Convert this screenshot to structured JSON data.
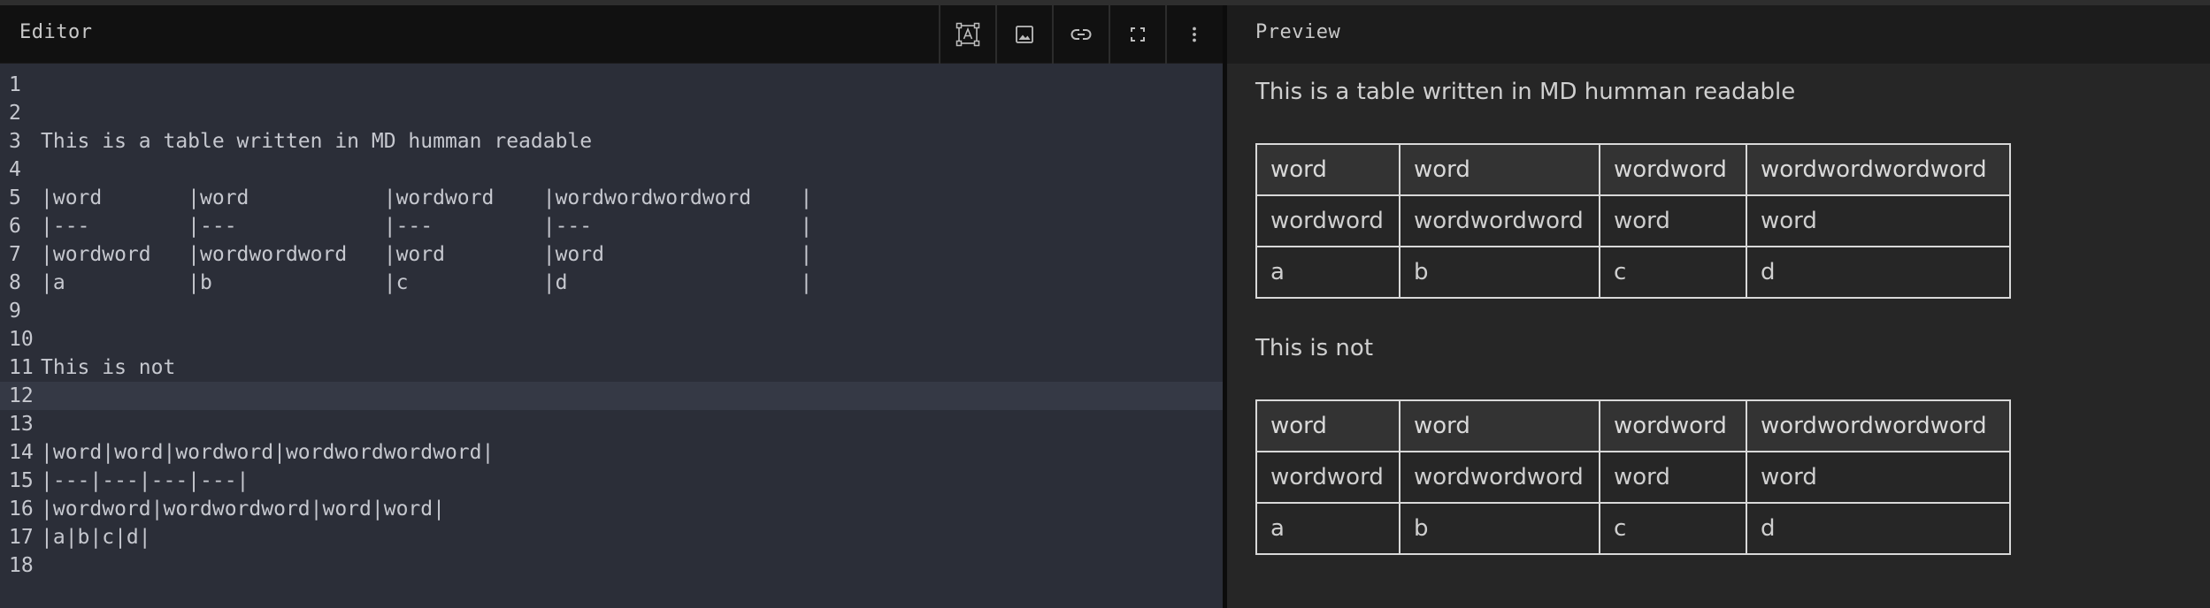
{
  "editor": {
    "title": "Editor",
    "toolbar": [
      {
        "name": "text-frame-icon"
      },
      {
        "name": "image-icon"
      },
      {
        "name": "link-icon"
      },
      {
        "name": "fullscreen-icon"
      },
      {
        "name": "more-vertical-icon"
      }
    ],
    "active_line": 12,
    "lines": [
      {
        "n": "1",
        "text": ""
      },
      {
        "n": "2",
        "text": ""
      },
      {
        "n": "3",
        "text": "This is a table written in MD humman readable"
      },
      {
        "n": "4",
        "text": ""
      },
      {
        "n": "5",
        "text": "|word       |word           |wordword    |wordwordwordword    |"
      },
      {
        "n": "6",
        "text": "|---        |---            |---         |---                 |"
      },
      {
        "n": "7",
        "text": "|wordword   |wordwordword   |word        |word                |"
      },
      {
        "n": "8",
        "text": "|a          |b              |c           |d                   |"
      },
      {
        "n": "9",
        "text": ""
      },
      {
        "n": "10",
        "text": ""
      },
      {
        "n": "11",
        "text": "This is not"
      },
      {
        "n": "12",
        "text": ""
      },
      {
        "n": "13",
        "text": ""
      },
      {
        "n": "14",
        "text": "|word|word|wordword|wordwordwordword|"
      },
      {
        "n": "15",
        "text": "|---|---|---|---|"
      },
      {
        "n": "16",
        "text": "|wordword|wordwordword|word|word|"
      },
      {
        "n": "17",
        "text": "|a|b|c|d|"
      },
      {
        "n": "18",
        "text": ""
      }
    ]
  },
  "preview": {
    "title": "Preview",
    "para1": "This is a table written in MD humman readable",
    "para2": "This is not",
    "table1": {
      "headers": [
        "word",
        "word",
        "wordword",
        "wordwordwordword"
      ],
      "rows": [
        [
          "wordword",
          "wordwordword",
          "word",
          "word"
        ],
        [
          "a",
          "b",
          "c",
          "d"
        ]
      ]
    },
    "table2": {
      "headers": [
        "word",
        "word",
        "wordword",
        "wordwordwordword"
      ],
      "rows": [
        [
          "wordword",
          "wordwordword",
          "word",
          "word"
        ],
        [
          "a",
          "b",
          "c",
          "d"
        ]
      ]
    }
  },
  "colors": {
    "editor_bg": "#2b2e38",
    "header_bg": "#111111",
    "preview_bg": "#262626",
    "table_border": "#d8d8d8"
  }
}
